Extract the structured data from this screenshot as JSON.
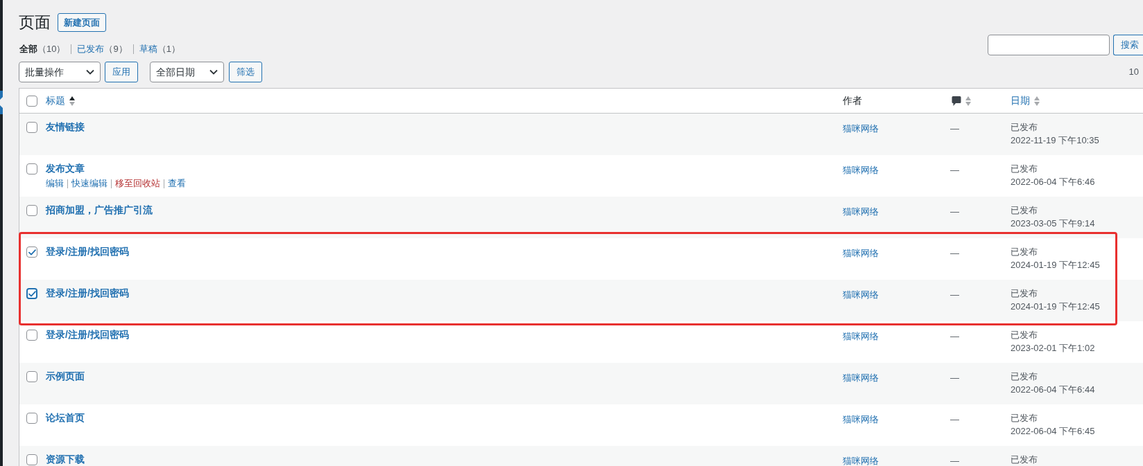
{
  "page": {
    "title": "页面",
    "add_new_button": "新建页面"
  },
  "views": [
    {
      "label": "全部",
      "count": "（10）",
      "selected": true
    },
    {
      "label": "已发布",
      "count": "（9）",
      "selected": false
    },
    {
      "label": "草稿",
      "count": "（1）",
      "selected": false
    }
  ],
  "search": {
    "button": "搜索"
  },
  "toolbar": {
    "bulk_actions": "批量操作",
    "apply_button": "应用",
    "date_filter": "全部日期",
    "filter_button": "筛选",
    "items_count": "10"
  },
  "table": {
    "select_all_checked": false,
    "columns": [
      {
        "kind": "link",
        "label": "标题",
        "sorted": true
      },
      {
        "kind": "text",
        "label": "作者"
      },
      {
        "kind": "comments",
        "sorted": false
      },
      {
        "kind": "link",
        "label": "日期",
        "sorted": false
      }
    ],
    "rows": [
      {
        "title": "友情链接",
        "checked": false,
        "focused": false,
        "highlighted": false,
        "author": "猫咪网络",
        "comments": "—",
        "status": "已发布",
        "date": "2022-11-19 下午10:35"
      },
      {
        "title": "发布文章",
        "checked": false,
        "focused": false,
        "highlighted": false,
        "actions": [
          {
            "label": "编辑",
            "kind": "normal"
          },
          {
            "label": "快速编辑",
            "kind": "normal"
          },
          {
            "label": "移至回收站",
            "kind": "danger"
          },
          {
            "label": "查看",
            "kind": "normal"
          }
        ],
        "author": "猫咪网络",
        "comments": "—",
        "status": "已发布",
        "date": "2022-06-04 下午6:46"
      },
      {
        "title": "招商加盟，广告推广引流",
        "checked": false,
        "focused": false,
        "highlighted": false,
        "author": "猫咪网络",
        "comments": "—",
        "status": "已发布",
        "date": "2023-03-05 下午9:14"
      },
      {
        "title": "登录/注册/找回密码",
        "checked": true,
        "focused": false,
        "highlighted": true,
        "author": "猫咪网络",
        "comments": "—",
        "status": "已发布",
        "date": "2024-01-19 下午12:45"
      },
      {
        "title": "登录/注册/找回密码",
        "checked": true,
        "focused": true,
        "highlighted": true,
        "author": "猫咪网络",
        "comments": "—",
        "status": "已发布",
        "date": "2024-01-19 下午12:45"
      },
      {
        "title": "登录/注册/找回密码",
        "checked": false,
        "focused": false,
        "highlighted": false,
        "author": "猫咪网络",
        "comments": "—",
        "status": "已发布",
        "date": "2023-02-01 下午1:02"
      },
      {
        "title": "示例页面",
        "checked": false,
        "focused": false,
        "highlighted": false,
        "author": "猫咪网络",
        "comments": "—",
        "status": "已发布",
        "date": "2022-06-04 下午6:44"
      },
      {
        "title": "论坛首页",
        "checked": false,
        "focused": false,
        "highlighted": false,
        "author": "猫咪网络",
        "comments": "—",
        "status": "已发布",
        "date": "2022-06-04 下午6:45"
      },
      {
        "title": "资源下载",
        "checked": false,
        "focused": false,
        "highlighted": false,
        "author": "猫咪网络",
        "comments": "—",
        "status": "已发布"
      }
    ]
  }
}
